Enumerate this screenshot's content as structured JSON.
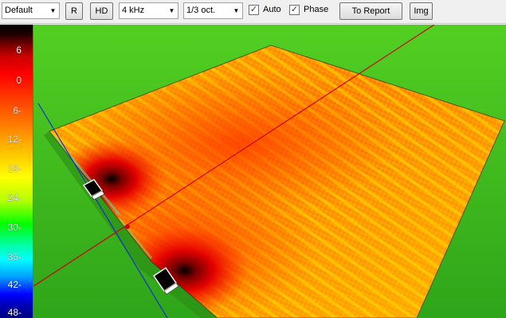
{
  "toolbar": {
    "preset": "Default",
    "reset_label": "R",
    "hd_label": "HD",
    "frequency": "4 kHz",
    "bandwidth": "1/3 oct.",
    "auto_checked": true,
    "auto_label": "Auto",
    "phase_checked": true,
    "phase_label": "Phase",
    "report_label": "To Report",
    "img_label": "Img"
  },
  "scale": {
    "ticks": [
      "6",
      "0",
      "6-",
      "12-",
      "18-",
      "24-",
      "30-",
      "36-",
      "42-",
      "48-"
    ]
  },
  "colors": {
    "background_green": "#3fb91e",
    "max": "#000000",
    "hot": "#ff0000",
    "mid": "#ffff00",
    "cool": "#00ffff",
    "min": "#0000ff",
    "axis_red": "#d00000",
    "axis_blue": "#1530d0"
  },
  "icons": {
    "dropdown": "chevron-down-icon",
    "check": "check-mark-icon",
    "speaker": "speaker-icon"
  }
}
